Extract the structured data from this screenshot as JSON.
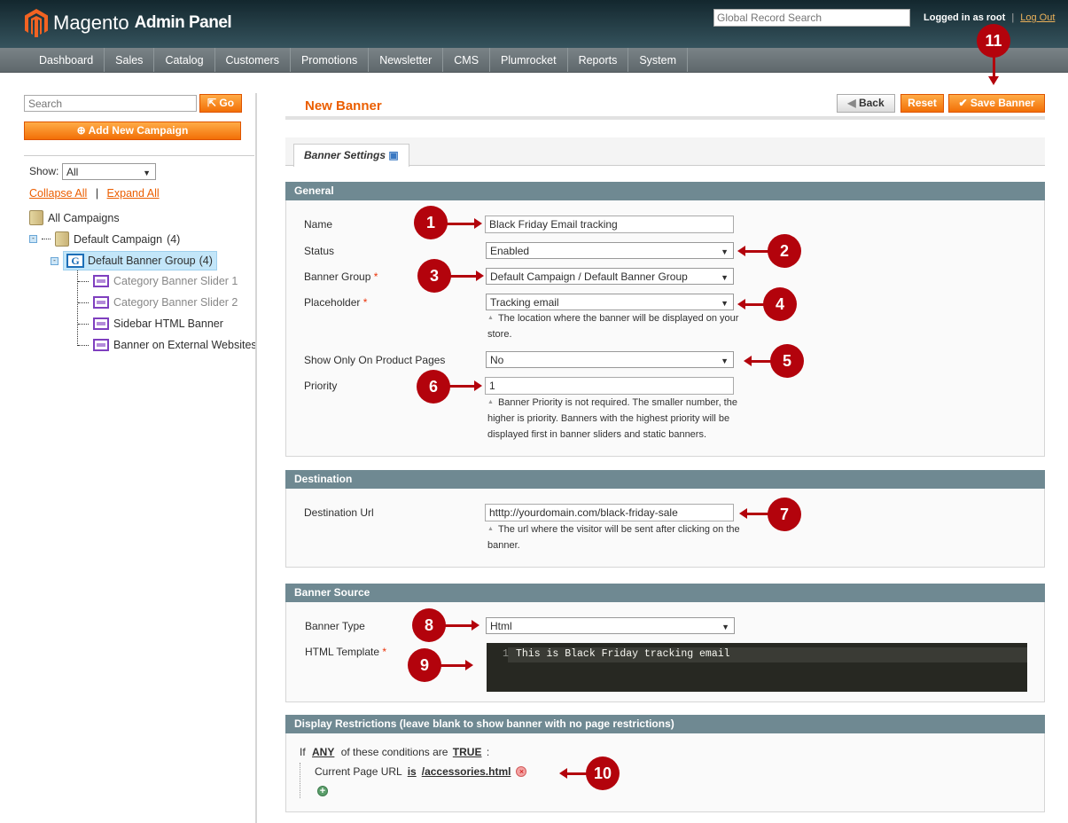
{
  "header": {
    "brand": "Magento",
    "brand_sub": "Admin Panel",
    "global_search_placeholder": "Global Record Search",
    "logged_in": "Logged in as root",
    "separator": "|",
    "logout": "Log Out"
  },
  "nav": [
    "Dashboard",
    "Sales",
    "Catalog",
    "Customers",
    "Promotions",
    "Newsletter",
    "CMS",
    "Plumrocket",
    "Reports",
    "System"
  ],
  "sidebar": {
    "search_placeholder": "Search",
    "go_label": "Go",
    "add_campaign": "Add New Campaign",
    "show_label": "Show:",
    "show_value": "All",
    "collapse_all": "Collapse All",
    "sep": "|",
    "expand_all": "Expand All",
    "tree": {
      "root": "All Campaigns",
      "campaign": "Default Campaign",
      "campaign_count": "(4)",
      "group": "Default Banner Group",
      "group_count": "(4)",
      "banners": [
        "Category Banner Slider 1",
        "Category Banner Slider 2",
        "Sidebar HTML Banner",
        "Banner on External Websites"
      ]
    }
  },
  "page": {
    "title": "New Banner",
    "back": "Back",
    "reset": "Reset",
    "save": "Save Banner",
    "tab": "Banner Settings"
  },
  "general": {
    "title": "General",
    "name_label": "Name",
    "name_value": "Black Friday Email tracking",
    "status_label": "Status",
    "status_value": "Enabled",
    "group_label": "Banner Group",
    "group_value": "Default Campaign / Default Banner Group",
    "placeholder_label": "Placeholder",
    "placeholder_value": "Tracking email",
    "placeholder_note": "The location where the banner will be displayed on your store.",
    "product_label": "Show Only On Product Pages",
    "product_value": "No",
    "priority_label": "Priority",
    "priority_value": "1",
    "priority_note": "Banner Priority is not required. The smaller number, the higher is priority. Banners with the highest priority will be displayed first in banner sliders and static banners."
  },
  "destination": {
    "title": "Destination",
    "url_label": "Destination Url",
    "url_value": "htttp://yourdomain.com/black-friday-sale",
    "url_note": "The url where the visitor will be sent after clicking on the banner."
  },
  "source": {
    "title": "Banner Source",
    "type_label": "Banner Type",
    "type_value": "Html",
    "template_label": "HTML Template",
    "line_no": "1",
    "code": "This is Black Friday tracking email"
  },
  "restrictions": {
    "title": "Display Restrictions (leave blank to show banner with no page restrictions)",
    "if": "If",
    "any": "ANY",
    "of_these": "of these conditions are",
    "true": "TRUE",
    "colon": ":",
    "cond_attr": "Current Page URL",
    "cond_op": "is",
    "cond_value": "/accessories.html"
  },
  "required_mark": "*",
  "markers": [
    "1",
    "2",
    "3",
    "4",
    "5",
    "6",
    "7",
    "8",
    "9",
    "10",
    "11"
  ],
  "colors": {
    "accent": "#eb5e00",
    "marker": "#b3030c",
    "fieldset_header": "#6f8992"
  }
}
